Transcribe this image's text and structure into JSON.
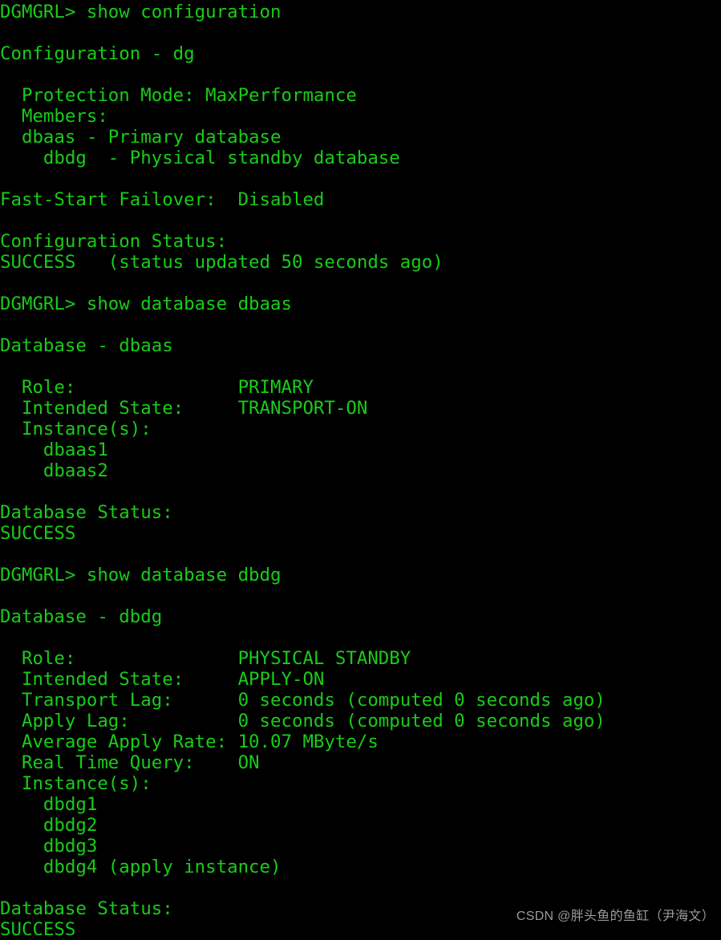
{
  "terminal": {
    "prompt": "DGMGRL>",
    "foreground_color": "#19cc19",
    "background_color": "#000000",
    "lines": [
      "DGMGRL> show configuration",
      "",
      "Configuration - dg",
      "",
      "  Protection Mode: MaxPerformance",
      "  Members:",
      "  dbaas - Primary database",
      "    dbdg  - Physical standby database",
      "",
      "Fast-Start Failover:  Disabled",
      "",
      "Configuration Status:",
      "SUCCESS   (status updated 50 seconds ago)",
      "",
      "DGMGRL> show database dbaas",
      "",
      "Database - dbaas",
      "",
      "  Role:               PRIMARY",
      "  Intended State:     TRANSPORT-ON",
      "  Instance(s):",
      "    dbaas1",
      "    dbaas2",
      "",
      "Database Status:",
      "SUCCESS",
      "",
      "DGMGRL> show database dbdg",
      "",
      "Database - dbdg",
      "",
      "  Role:               PHYSICAL STANDBY",
      "  Intended State:     APPLY-ON",
      "  Transport Lag:      0 seconds (computed 0 seconds ago)",
      "  Apply Lag:          0 seconds (computed 0 seconds ago)",
      "  Average Apply Rate: 10.07 MByte/s",
      "  Real Time Query:    ON",
      "  Instance(s):",
      "    dbdg1",
      "    dbdg2",
      "    dbdg3",
      "    dbdg4 (apply instance)",
      "",
      "Database Status:",
      "SUCCESS"
    ],
    "commands": [
      "show configuration",
      "show database dbaas",
      "show database dbdg"
    ],
    "configuration": {
      "header": "Configuration - dg",
      "name": "dg",
      "protection_mode_label": "Protection Mode:",
      "protection_mode_value": "MaxPerformance",
      "members_label": "Members:",
      "members": [
        "dbaas - Primary database",
        "dbdg  - Physical standby database"
      ],
      "fast_start_failover_label": "Fast-Start Failover:",
      "fast_start_failover_value": "Disabled",
      "status_label": "Configuration Status:",
      "status_value": "SUCCESS",
      "status_detail": "(status updated 50 seconds ago)"
    },
    "database_dbaas": {
      "header": "Database - dbaas",
      "name": "dbaas",
      "role_label": "Role:",
      "role_value": "PRIMARY",
      "intended_state_label": "Intended State:",
      "intended_state_value": "TRANSPORT-ON",
      "instances_label": "Instance(s):",
      "instances": [
        "dbaas1",
        "dbaas2"
      ],
      "status_label": "Database Status:",
      "status_value": "SUCCESS"
    },
    "database_dbdg": {
      "header": "Database - dbdg",
      "name": "dbdg",
      "role_label": "Role:",
      "role_value": "PHYSICAL STANDBY",
      "intended_state_label": "Intended State:",
      "intended_state_value": "APPLY-ON",
      "transport_lag_label": "Transport Lag:",
      "transport_lag_value": "0 seconds (computed 0 seconds ago)",
      "apply_lag_label": "Apply Lag:",
      "apply_lag_value": "0 seconds (computed 0 seconds ago)",
      "average_apply_rate_label": "Average Apply Rate:",
      "average_apply_rate_value": "10.07 MByte/s",
      "real_time_query_label": "Real Time Query:",
      "real_time_query_value": "ON",
      "instances_label": "Instance(s):",
      "instances": [
        "dbdg1",
        "dbdg2",
        "dbdg3",
        "dbdg4 (apply instance)"
      ],
      "status_label": "Database Status:",
      "status_value": "SUCCESS"
    }
  },
  "watermark": {
    "text": "CSDN @胖头鱼的鱼缸（尹海文）",
    "color": "#9a9a9a"
  }
}
